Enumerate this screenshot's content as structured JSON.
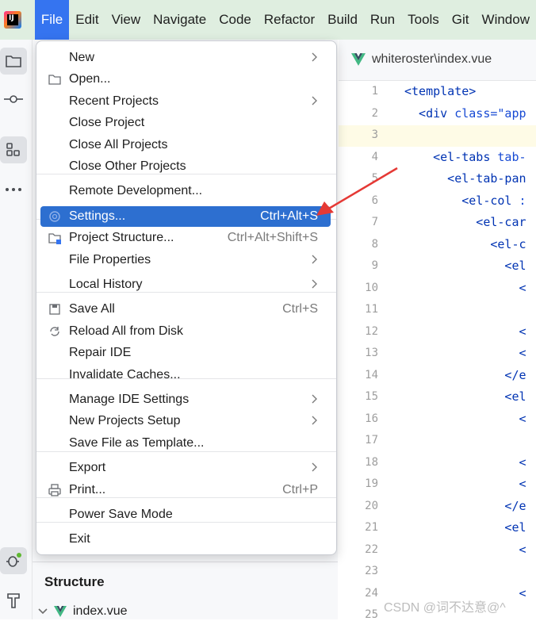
{
  "menubar": {
    "items": [
      "File",
      "Edit",
      "View",
      "Navigate",
      "Code",
      "Refactor",
      "Build",
      "Run",
      "Tools",
      "Git",
      "Window"
    ],
    "active": "File"
  },
  "editor": {
    "tab_label": "whiteroster\\index.vue",
    "line_numbers": [
      "1",
      "2",
      "3",
      "4",
      "5",
      "6",
      "7",
      "8",
      "9",
      "10",
      "11",
      "12",
      "13",
      "14",
      "15",
      "16",
      "17",
      "18",
      "19",
      "20",
      "21",
      "22",
      "23",
      "24",
      "25"
    ],
    "code_lines": [
      {
        "tag": "<template>",
        "rest": ""
      },
      {
        "tag": "  <div",
        "rest": " class=\"app"
      },
      {
        "tag": "",
        "rest": ""
      },
      {
        "tag": "    <el-tabs",
        "rest": " tab-"
      },
      {
        "tag": "      <el-tab-pan",
        "rest": ""
      },
      {
        "tag": "        <el-col",
        "rest": " :"
      },
      {
        "tag": "          <el-car",
        "rest": ""
      },
      {
        "tag": "            <el-c",
        "rest": ""
      },
      {
        "tag": "              <el",
        "rest": ""
      },
      {
        "tag": "                <",
        "rest": ""
      },
      {
        "tag": "",
        "rest": ""
      },
      {
        "tag": "                <",
        "rest": ""
      },
      {
        "tag": "                <",
        "rest": ""
      },
      {
        "tag": "              </e",
        "rest": ""
      },
      {
        "tag": "              <el",
        "rest": ""
      },
      {
        "tag": "                <",
        "rest": ""
      },
      {
        "tag": "",
        "rest": ""
      },
      {
        "tag": "                <",
        "rest": ""
      },
      {
        "tag": "                <",
        "rest": ""
      },
      {
        "tag": "              </e",
        "rest": ""
      },
      {
        "tag": "              <el",
        "rest": ""
      },
      {
        "tag": "                <",
        "rest": ""
      },
      {
        "tag": "",
        "rest": ""
      },
      {
        "tag": "                <",
        "rest": ""
      },
      {
        "tag": "",
        "rest": ""
      }
    ]
  },
  "file_menu": {
    "items": [
      {
        "label": "New",
        "shortcut": "",
        "submenu": true,
        "icon": ""
      },
      {
        "label": "Open...",
        "shortcut": "",
        "submenu": false,
        "icon": "folder-icon"
      },
      {
        "label": "Recent Projects",
        "shortcut": "",
        "submenu": true,
        "icon": ""
      },
      {
        "label": "Close Project",
        "shortcut": "",
        "submenu": false,
        "icon": ""
      },
      {
        "label": "Close All Projects",
        "shortcut": "",
        "submenu": false,
        "icon": ""
      },
      {
        "label": "Close Other Projects",
        "shortcut": "",
        "submenu": false,
        "icon": ""
      },
      {
        "label": "Remote Development...",
        "shortcut": "",
        "submenu": false,
        "icon": ""
      },
      {
        "label": "Settings...",
        "shortcut": "Ctrl+Alt+S",
        "submenu": false,
        "icon": "gear-icon",
        "selected": true
      },
      {
        "label": "Project Structure...",
        "shortcut": "Ctrl+Alt+Shift+S",
        "submenu": false,
        "icon": "project-structure-icon"
      },
      {
        "label": "File Properties",
        "shortcut": "",
        "submenu": true,
        "icon": ""
      },
      {
        "label": "Local History",
        "shortcut": "",
        "submenu": true,
        "icon": ""
      },
      {
        "label": "Save All",
        "shortcut": "Ctrl+S",
        "submenu": false,
        "icon": "save-icon"
      },
      {
        "label": "Reload All from Disk",
        "shortcut": "",
        "submenu": false,
        "icon": "reload-icon"
      },
      {
        "label": "Repair IDE",
        "shortcut": "",
        "submenu": false,
        "icon": ""
      },
      {
        "label": "Invalidate Caches...",
        "shortcut": "",
        "submenu": false,
        "icon": ""
      },
      {
        "label": "Manage IDE Settings",
        "shortcut": "",
        "submenu": true,
        "icon": ""
      },
      {
        "label": "New Projects Setup",
        "shortcut": "",
        "submenu": true,
        "icon": ""
      },
      {
        "label": "Save File as Template...",
        "shortcut": "",
        "submenu": false,
        "icon": ""
      },
      {
        "label": "Export",
        "shortcut": "",
        "submenu": true,
        "icon": ""
      },
      {
        "label": "Print...",
        "shortcut": "Ctrl+P",
        "submenu": false,
        "icon": "print-icon"
      },
      {
        "label": "Power Save Mode",
        "shortcut": "",
        "submenu": false,
        "icon": ""
      },
      {
        "label": "Exit",
        "shortcut": "",
        "submenu": false,
        "icon": ""
      }
    ]
  },
  "structure": {
    "header": "Structure",
    "file": "index.vue"
  },
  "watermark": "CSDN @词不达意@^",
  "colors": {
    "menubar_bg": "#dfeee0",
    "active_menu": "#3574f0",
    "selected_item": "#2d6fd0",
    "annotation_arrow": "#e53935"
  }
}
